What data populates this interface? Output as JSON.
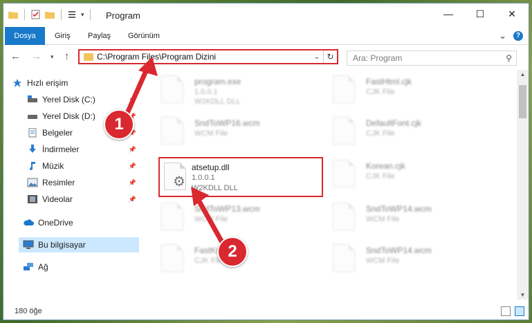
{
  "window": {
    "title": "Program",
    "minimize": "—",
    "maximize": "☐",
    "close": "✕"
  },
  "ribbon": {
    "tabs": [
      "Dosya",
      "Giriş",
      "Paylaş",
      "Görünüm"
    ],
    "expand": "⌄",
    "help": "?"
  },
  "address": {
    "path": "C:\\Program Files\\Program Dizini",
    "dropdown": "⌄",
    "refresh": "↻"
  },
  "search": {
    "placeholder": "Ara: Program"
  },
  "nav": {
    "items": [
      {
        "label": "Hızlı erişim",
        "pinned": false
      },
      {
        "label": "Yerel Disk (C:)",
        "pinned": true
      },
      {
        "label": "Yerel Disk (D:)",
        "pinned": true
      },
      {
        "label": "Belgeler",
        "pinned": true
      },
      {
        "label": "İndirmeler",
        "pinned": true
      },
      {
        "label": "Müzik",
        "pinned": true
      },
      {
        "label": "Resimler",
        "pinned": true
      },
      {
        "label": "Videolar",
        "pinned": true
      },
      {
        "label": "OneDrive",
        "pinned": false
      },
      {
        "label": "Bu bilgisayar",
        "pinned": false
      },
      {
        "label": "Ağ",
        "pinned": false
      }
    ]
  },
  "files": {
    "left": [
      {
        "name": "program.exe",
        "line2": "1.0.0.1",
        "line3": "W2KDLL DLL"
      },
      {
        "name": "SndToWP16.wcm",
        "line2": "WCM File",
        "line3": ""
      },
      {
        "name": "atsetup.dll",
        "line2": "1.0.0.1",
        "line3": "W2KDLL DLL"
      },
      {
        "name": "SndToWP13.wcm",
        "line2": "WCM File",
        "line3": ""
      },
      {
        "name": "FastKr",
        "line2": "CJK File",
        "line3": ""
      }
    ],
    "right": [
      {
        "name": "FastHtml.cjk",
        "line2": "CJK File",
        "line3": ""
      },
      {
        "name": "DefaultFont.cjk",
        "line2": "CJK File",
        "line3": ""
      },
      {
        "name": "Korean.cjk",
        "line2": "CJK File",
        "line3": ""
      },
      {
        "name": "SndToWP14.wcm",
        "line2": "WCM File",
        "line3": ""
      },
      {
        "name": "SndToWP14.wcm",
        "line2": "WCM File",
        "line3": ""
      }
    ]
  },
  "status": {
    "count": "180 öğe"
  },
  "callouts": [
    "1",
    "2"
  ],
  "colors": {
    "accent": "#1979ca",
    "highlight": "#d9282f",
    "selection": "#cce8ff"
  }
}
